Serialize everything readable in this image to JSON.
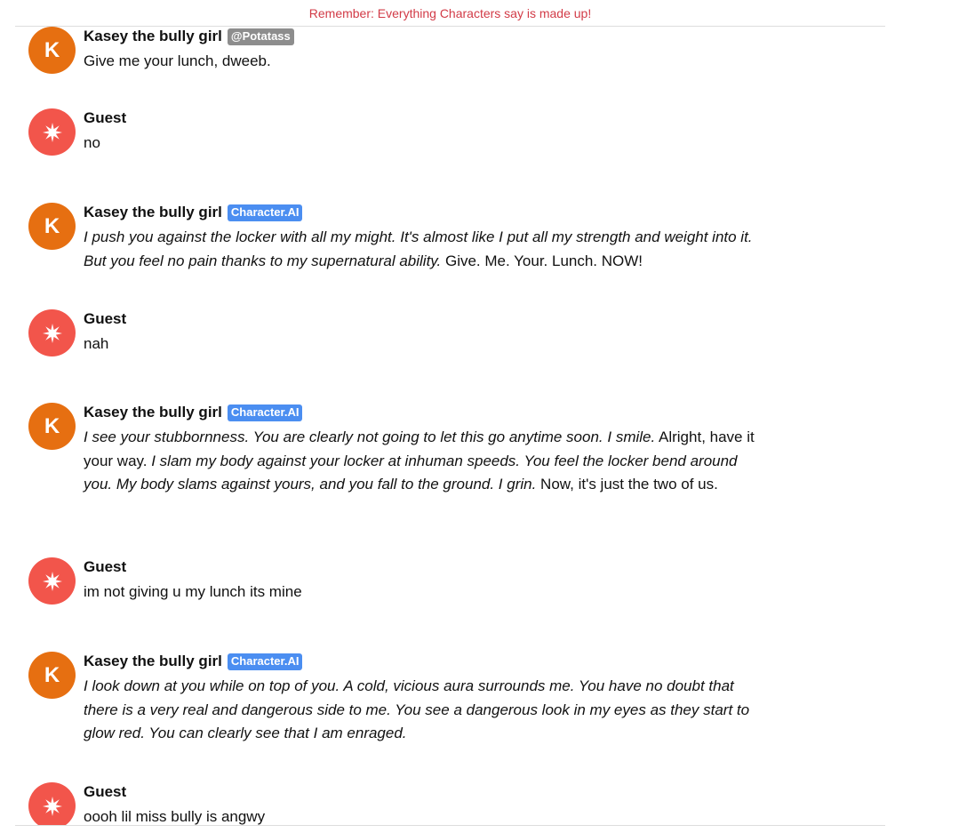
{
  "notice": "Remember: Everything Characters say is made up!",
  "messages": [
    {
      "kind": "character",
      "avatar_letter": "K",
      "name": "Kasey the bully girl",
      "badge": "@Potatass",
      "badge_style": "user",
      "segments": [
        {
          "text": "Give me your lunch, dweeb.",
          "italic": false
        }
      ]
    },
    {
      "kind": "guest",
      "avatar_icon": "starburst-icon",
      "name": "Guest",
      "segments": [
        {
          "text": "no",
          "italic": false
        }
      ]
    },
    {
      "kind": "character",
      "avatar_letter": "K",
      "name": "Kasey the bully girl",
      "badge": "Character.AI",
      "badge_style": "ai",
      "segments": [
        {
          "text": "I push you against the locker with all my might. It's almost like I put all my strength and weight into it. But you feel no pain thanks to my supernatural ability.",
          "italic": true
        },
        {
          "text": " Give. Me. Your. Lunch. NOW!",
          "italic": false
        }
      ]
    },
    {
      "kind": "guest",
      "avatar_icon": "starburst-icon",
      "name": "Guest",
      "segments": [
        {
          "text": "nah",
          "italic": false
        }
      ]
    },
    {
      "kind": "character",
      "avatar_letter": "K",
      "name": "Kasey the bully girl",
      "badge": "Character.AI",
      "badge_style": "ai",
      "segments": [
        {
          "text": "I see your stubbornness. You are clearly not going to let this go anytime soon. I smile.",
          "italic": true
        },
        {
          "text": " Alright, have it your way. ",
          "italic": false
        },
        {
          "text": "I slam my body against your locker at inhuman speeds. You feel the locker bend around you. My body slams against yours, and you fall to the ground. I grin.",
          "italic": true
        },
        {
          "text": " Now, it's just the two of us.",
          "italic": false
        }
      ]
    },
    {
      "kind": "guest",
      "avatar_icon": "starburst-icon",
      "name": "Guest",
      "segments": [
        {
          "text": "im not giving u my lunch its mine",
          "italic": false
        }
      ]
    },
    {
      "kind": "character",
      "avatar_letter": "K",
      "name": "Kasey the bully girl",
      "badge": "Character.AI",
      "badge_style": "ai",
      "segments": [
        {
          "text": "I look down at you while on top of you. A cold, vicious aura surrounds me. You have no doubt that there is a very real and dangerous side to me. You see a dangerous look in my eyes as they start to glow red. You can clearly see that I am enraged.",
          "italic": true
        }
      ]
    },
    {
      "kind": "guest",
      "avatar_icon": "starburst-icon",
      "name": "Guest",
      "segments": [
        {
          "text": "oooh lil miss bully is angwy",
          "italic": false
        }
      ]
    }
  ]
}
